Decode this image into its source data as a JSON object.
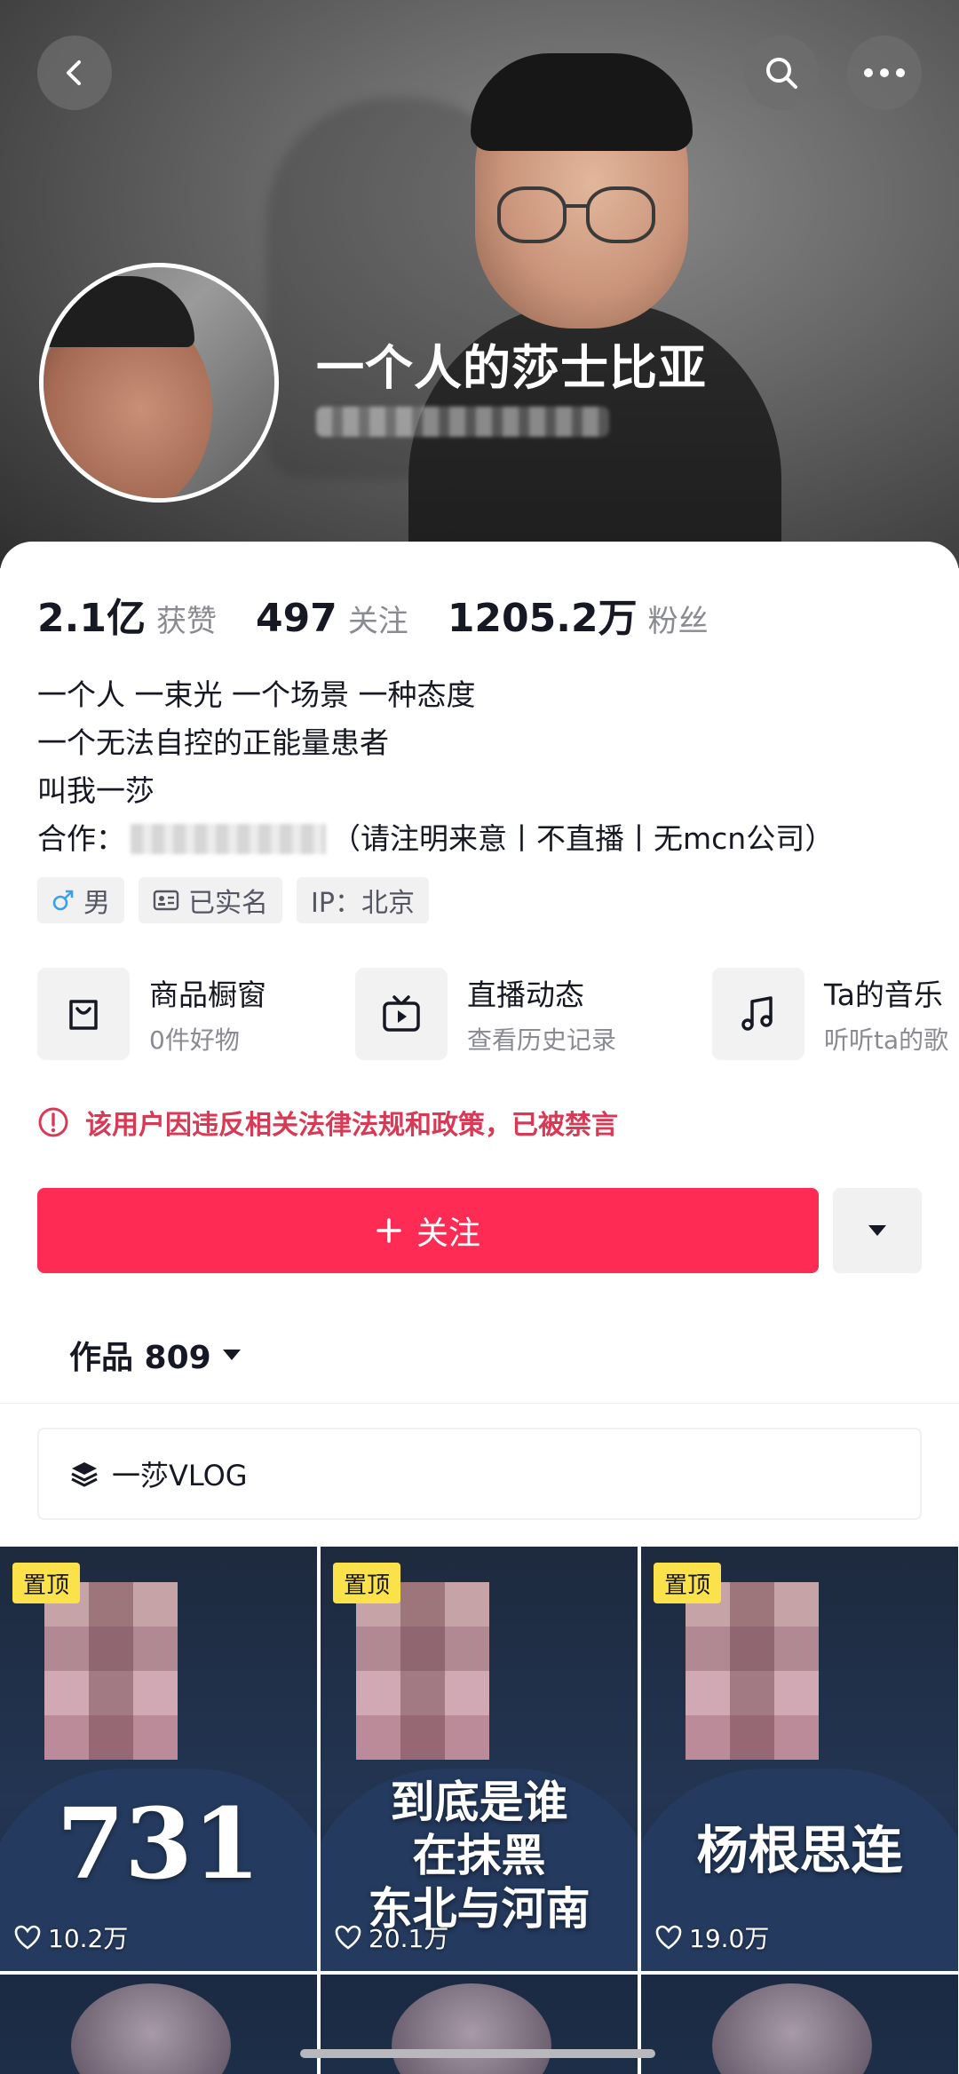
{
  "profile": {
    "name": "一个人的莎士比亚"
  },
  "stats": [
    {
      "value": "2.1亿",
      "label": "获赞"
    },
    {
      "value": "497",
      "label": "关注"
    },
    {
      "value": "1205.2万",
      "label": "粉丝"
    }
  ],
  "bio": {
    "line1": "一个人 一束光 一个场景 一种态度",
    "line2": "一个无法自控的正能量患者",
    "line3": "叫我一莎",
    "coop_prefix": "合作：",
    "coop_suffix": "（请注明来意丨不直播丨无mcn公司）"
  },
  "tags": {
    "gender": "男",
    "verified": "已实名",
    "ip": "IP：北京"
  },
  "features": [
    {
      "title": "商品橱窗",
      "sub": "0件好物",
      "icon": "shopping-bag-icon"
    },
    {
      "title": "直播动态",
      "sub": "查看历史记录",
      "icon": "tv-icon"
    },
    {
      "title": "Ta的音乐",
      "sub": "听听ta的歌",
      "icon": "music-note-icon"
    }
  ],
  "notice": "该用户因违反相关法律法规和政策，已被禁言",
  "follow_label": "关注",
  "works": {
    "label": "作品 809"
  },
  "collection_label": "一莎VLOG",
  "videos": [
    {
      "pin": "置顶",
      "overlay": "731",
      "likes": "10.2万"
    },
    {
      "pin": "置顶",
      "overlay_lines": [
        "到底是谁",
        "在抹黑",
        "东北与河南"
      ],
      "likes": "20.1万"
    },
    {
      "pin": "置顶",
      "overlay": "杨根思连",
      "likes": "19.0万"
    }
  ],
  "colors": {
    "accent": "#fe2c55",
    "warning": "#d83a56",
    "pin_badge": "#fbe14a"
  }
}
